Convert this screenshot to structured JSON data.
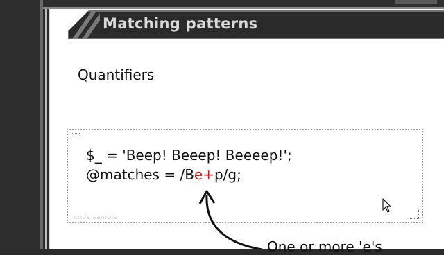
{
  "slide": {
    "title": "Matching patterns",
    "subheading": "Quantifiers"
  },
  "code_sample": {
    "caption": "code sample",
    "line1": "$_ = 'Beep! Beeep! Beeeep!';",
    "line2_prefix": "@matches = /B",
    "line2_highlight": "e+",
    "line2_suffix": "p/g;"
  },
  "annotation": {
    "text": "One or more 'e's"
  },
  "colors": {
    "highlight": "#d11a1a",
    "title_bar": "#2a2a2a",
    "frame": "#2e2e2e"
  },
  "icons": {
    "cursor": "mouse-pointer-icon"
  }
}
